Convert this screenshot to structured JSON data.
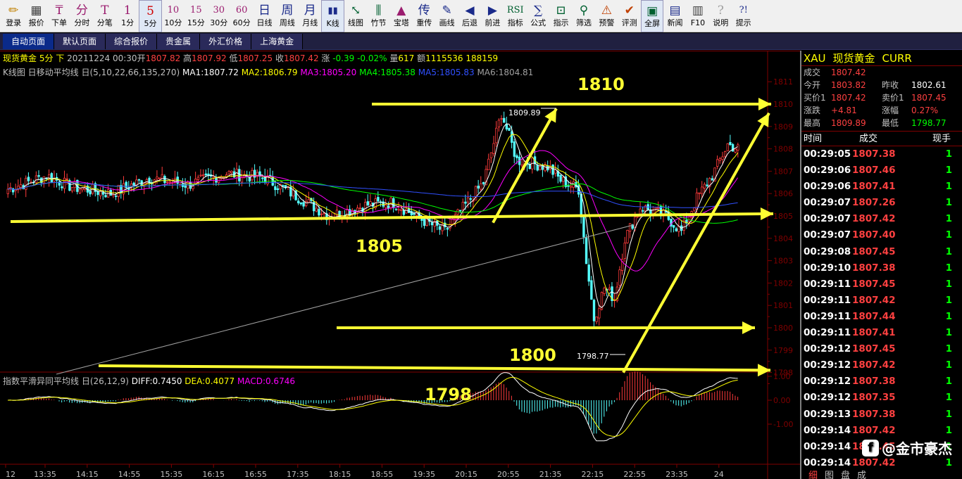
{
  "toolbar": [
    {
      "label": "登录",
      "icon": "✏",
      "color": "#c08000"
    },
    {
      "label": "报价",
      "icon": "▦",
      "color": "#404040"
    },
    {
      "label": "下单",
      "icon": "₸",
      "color": "#9b1d6f"
    },
    {
      "label": "分时",
      "icon": "分",
      "color": "#9b1d6f"
    },
    {
      "label": "分笔",
      "icon": "T",
      "color": "#9b1d6f"
    },
    {
      "label": "1分",
      "icon": "1",
      "color": "#9b1d6f"
    },
    {
      "label": "5分",
      "icon": "5",
      "color": "#d00000",
      "active": true
    },
    {
      "label": "10分",
      "icon": "10",
      "color": "#9b1d6f"
    },
    {
      "label": "15分",
      "icon": "15",
      "color": "#9b1d6f"
    },
    {
      "label": "30分",
      "icon": "30",
      "color": "#9b1d6f"
    },
    {
      "label": "60分",
      "icon": "60",
      "color": "#9b1d6f"
    },
    {
      "label": "日线",
      "icon": "日",
      "color": "#1a2a8a"
    },
    {
      "label": "周线",
      "icon": "周",
      "color": "#1a2a8a"
    },
    {
      "label": "月线",
      "icon": "月",
      "color": "#1a2a8a"
    },
    {
      "label": "K线",
      "icon": "▮▮",
      "color": "#1a2a8a",
      "active": true
    },
    {
      "label": "线图",
      "icon": "⤡",
      "color": "#006030"
    },
    {
      "label": "竹节",
      "icon": "⫼",
      "color": "#006030"
    },
    {
      "label": "宝塔",
      "icon": "▲",
      "color": "#9b1d6f"
    },
    {
      "label": "重传",
      "icon": "传",
      "color": "#1a2a8a"
    },
    {
      "label": "画线",
      "icon": "✎",
      "color": "#1a2a8a"
    },
    {
      "label": "后退",
      "icon": "◀",
      "color": "#1a2a8a"
    },
    {
      "label": "前进",
      "icon": "▶",
      "color": "#1a2a8a"
    },
    {
      "label": "指标",
      "icon": "RSI",
      "color": "#006030"
    },
    {
      "label": "公式",
      "icon": "∑",
      "color": "#1a2a8a"
    },
    {
      "label": "指示",
      "icon": "⊡",
      "color": "#006030"
    },
    {
      "label": "筛选",
      "icon": "⚲",
      "color": "#006030"
    },
    {
      "label": "预警",
      "icon": "⚠",
      "color": "#c04000"
    },
    {
      "label": "评测",
      "icon": "✔",
      "color": "#c04000"
    },
    {
      "label": "全屏",
      "icon": "▣",
      "color": "#006030",
      "active": true
    },
    {
      "label": "新闻",
      "icon": "▤",
      "color": "#1a2a8a"
    },
    {
      "label": "F10",
      "icon": "▥",
      "color": "#404040"
    },
    {
      "label": "说明",
      "icon": "?",
      "color": "#a0a0a0"
    },
    {
      "label": "提示",
      "icon": "?!",
      "color": "#1a2a8a"
    }
  ],
  "tabs": [
    {
      "label": "自动页面",
      "active": true
    },
    {
      "label": "默认页面"
    },
    {
      "label": "综合报价"
    },
    {
      "label": "贵金属"
    },
    {
      "label": "外汇价格"
    },
    {
      "label": "上海黄金"
    }
  ],
  "header": {
    "name": "现货黄金 5分 下",
    "datetime": "20211224 00:30",
    "open_label": "开",
    "open": "1807.82",
    "high_label": "高",
    "high": "1807.92",
    "low_label": "低",
    "low": "1807.25",
    "close_label": "收",
    "close": "1807.42",
    "change_label": "涨",
    "change": "-0.39",
    "change_pct": "-0.02%",
    "volume_label": "量",
    "volume": "617",
    "amount_label": "额",
    "amount": "1115536",
    "extra": "188159"
  },
  "ma_line": {
    "title": "K线图 日移动平均线 日(5,10,22,66,135,270)",
    "items": [
      {
        "label": "MA1:1807.72",
        "color": "#ffffff"
      },
      {
        "label": "MA2:1806.79",
        "color": "#ffff00"
      },
      {
        "label": "MA3:1805.20",
        "color": "#ff00ff"
      },
      {
        "label": "MA4:1805.38",
        "color": "#00ff00"
      },
      {
        "label": "MA5:1805.83",
        "color": "#3050ff"
      },
      {
        "label": "MA6:1804.81",
        "color": "#a0a0a0"
      }
    ]
  },
  "macd_line": {
    "title": "指数平滑异同平均线 日(26,12,9)",
    "items": [
      {
        "label": "DIFF:0.7450",
        "color": "#ffffff"
      },
      {
        "label": "DEA:0.4077",
        "color": "#ffff00"
      },
      {
        "label": "MACD:0.6746",
        "color": "#ff00ff"
      }
    ]
  },
  "price_axis": [
    "1811",
    "1810",
    "1809",
    "1808",
    "1807",
    "1806",
    "1805",
    "1804",
    "1803",
    "1802",
    "1801",
    "1800",
    "1799",
    "1798"
  ],
  "macd_axis": [
    "1.00",
    "0.00",
    "-1.00"
  ],
  "time_axis": [
    "12",
    "13:35",
    "14:15",
    "14:55",
    "15:35",
    "16:15",
    "16:55",
    "17:35",
    "18:15",
    "18:55",
    "19:35",
    "20:15",
    "20:55",
    "21:35",
    "22:15",
    "22:55",
    "23:35",
    "24"
  ],
  "annotations": {
    "level_1810": "1810",
    "level_1805": "1805",
    "level_1800": "1800",
    "level_1798": "1798",
    "peak_label": "1809.89",
    "trough_label": "1798.77"
  },
  "panel": {
    "symbol": "XAU",
    "name": "现货黄金",
    "code": "CURR",
    "quote": [
      {
        "l1": "成交",
        "v1": "1807.42",
        "c1": "#ff4040"
      },
      {
        "l1": "今开",
        "v1": "1803.82",
        "c1": "#ff4040",
        "l2": "昨收",
        "v2": "1802.61",
        "c2": "#ffffff"
      },
      {
        "l1": "买价1",
        "v1": "1807.42",
        "c1": "#ff4040",
        "l2": "卖价1",
        "v2": "1807.45",
        "c2": "#ff4040"
      },
      {
        "l1": "涨跌",
        "v1": "+4.81",
        "c1": "#ff4040",
        "l2": "涨幅",
        "v2": "0.27%",
        "c2": "#ff4040"
      },
      {
        "l1": "最高",
        "v1": "1809.89",
        "c1": "#ff4040",
        "l2": "最低",
        "v2": "1798.77",
        "c2": "#00ff00"
      }
    ],
    "tick_head": [
      "时间",
      "成交",
      "现手"
    ],
    "ticks": [
      [
        "00:29:05",
        "1807.38",
        "1"
      ],
      [
        "00:29:06",
        "1807.46",
        "1"
      ],
      [
        "00:29:06",
        "1807.41",
        "1"
      ],
      [
        "00:29:07",
        "1807.26",
        "1"
      ],
      [
        "00:29:07",
        "1807.42",
        "1"
      ],
      [
        "00:29:07",
        "1807.40",
        "1"
      ],
      [
        "00:29:08",
        "1807.45",
        "1"
      ],
      [
        "00:29:10",
        "1807.38",
        "1"
      ],
      [
        "00:29:11",
        "1807.45",
        "1"
      ],
      [
        "00:29:11",
        "1807.42",
        "1"
      ],
      [
        "00:29:11",
        "1807.44",
        "1"
      ],
      [
        "00:29:11",
        "1807.41",
        "1"
      ],
      [
        "00:29:12",
        "1807.45",
        "1"
      ],
      [
        "00:29:12",
        "1807.42",
        "1"
      ],
      [
        "00:29:12",
        "1807.38",
        "1"
      ],
      [
        "00:29:12",
        "1807.35",
        "1"
      ],
      [
        "00:29:13",
        "1807.38",
        "1"
      ],
      [
        "00:29:14",
        "1807.42",
        "1"
      ],
      [
        "00:29:14",
        "1807.45",
        "1"
      ],
      [
        "00:29:14",
        "1807.42",
        "1"
      ]
    ],
    "bottom_tabs": [
      "细",
      "图",
      "盘",
      "成"
    ],
    "watermark": "@金市豪杰",
    "watermark_icon": "f"
  }
}
